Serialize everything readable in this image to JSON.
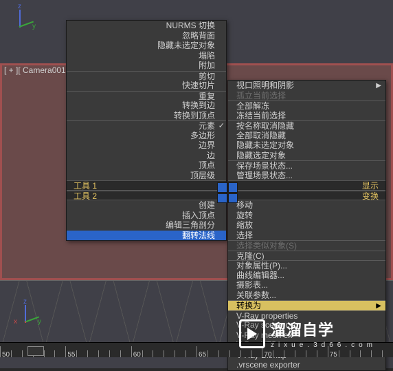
{
  "viewport_label": "[ + ][ Camera001 ][",
  "axis": {
    "x": "x",
    "y": "y",
    "z": "z"
  },
  "quad_titles": {
    "left1": "工具 1",
    "left2": "工具 2",
    "right1": "显示",
    "right2": "变换"
  },
  "menu_left_top": [
    "NURMS 切换",
    "忽略背面",
    "隐藏未选定对象",
    "塌陷",
    "附加",
    "剪切",
    "快速切片",
    "重复",
    "转换到边",
    "转换到顶点",
    "元素",
    "多边形",
    "边界",
    "边",
    "顶点",
    "顶层级"
  ],
  "menu_left_bottom": [
    "创建",
    "插入顶点",
    "编辑三角剖分",
    "翻转法线"
  ],
  "menu_right_top": [
    {
      "label": "视口照明和阴影",
      "submenu": true
    },
    {
      "label": "孤立当前选择",
      "disabled": true
    },
    {
      "label": "全部解冻"
    },
    {
      "label": "冻结当前选择"
    },
    {
      "label": "按名称取消隐藏"
    },
    {
      "label": "全部取消隐藏"
    },
    {
      "label": "隐藏未选定对象"
    },
    {
      "label": "隐藏选定对象"
    },
    {
      "label": "保存场景状态..."
    },
    {
      "label": "管理场景状态..."
    }
  ],
  "menu_right_bottom": [
    {
      "label": "移动"
    },
    {
      "label": "旋转"
    },
    {
      "label": "缩放"
    },
    {
      "label": "选择"
    },
    {
      "label": "选择类似对象(S)",
      "disabled": true
    },
    {
      "label": "克隆(C)"
    },
    {
      "label": "对象属性(P)..."
    },
    {
      "label": "曲线编辑器..."
    },
    {
      "label": "摄影表..."
    },
    {
      "label": "关联参数..."
    },
    {
      "label": "转换为",
      "submenu": true,
      "hover": true
    },
    {
      "label": "V-Ray properties"
    },
    {
      "label": "V-Ray scene c"
    },
    {
      "label": "V-Ray mesh ex"
    },
    {
      "label": "V-Ray VFB"
    },
    {
      "label": "V-Ray Bitmap"
    },
    {
      "label": ".vrscene exporter"
    }
  ],
  "timeline_labels": [
    "50",
    "55",
    "60",
    "65",
    "70",
    "75"
  ],
  "watermark": {
    "main": "溜溜自学",
    "sub": "zixue.3d66.com"
  },
  "element_checked": true
}
